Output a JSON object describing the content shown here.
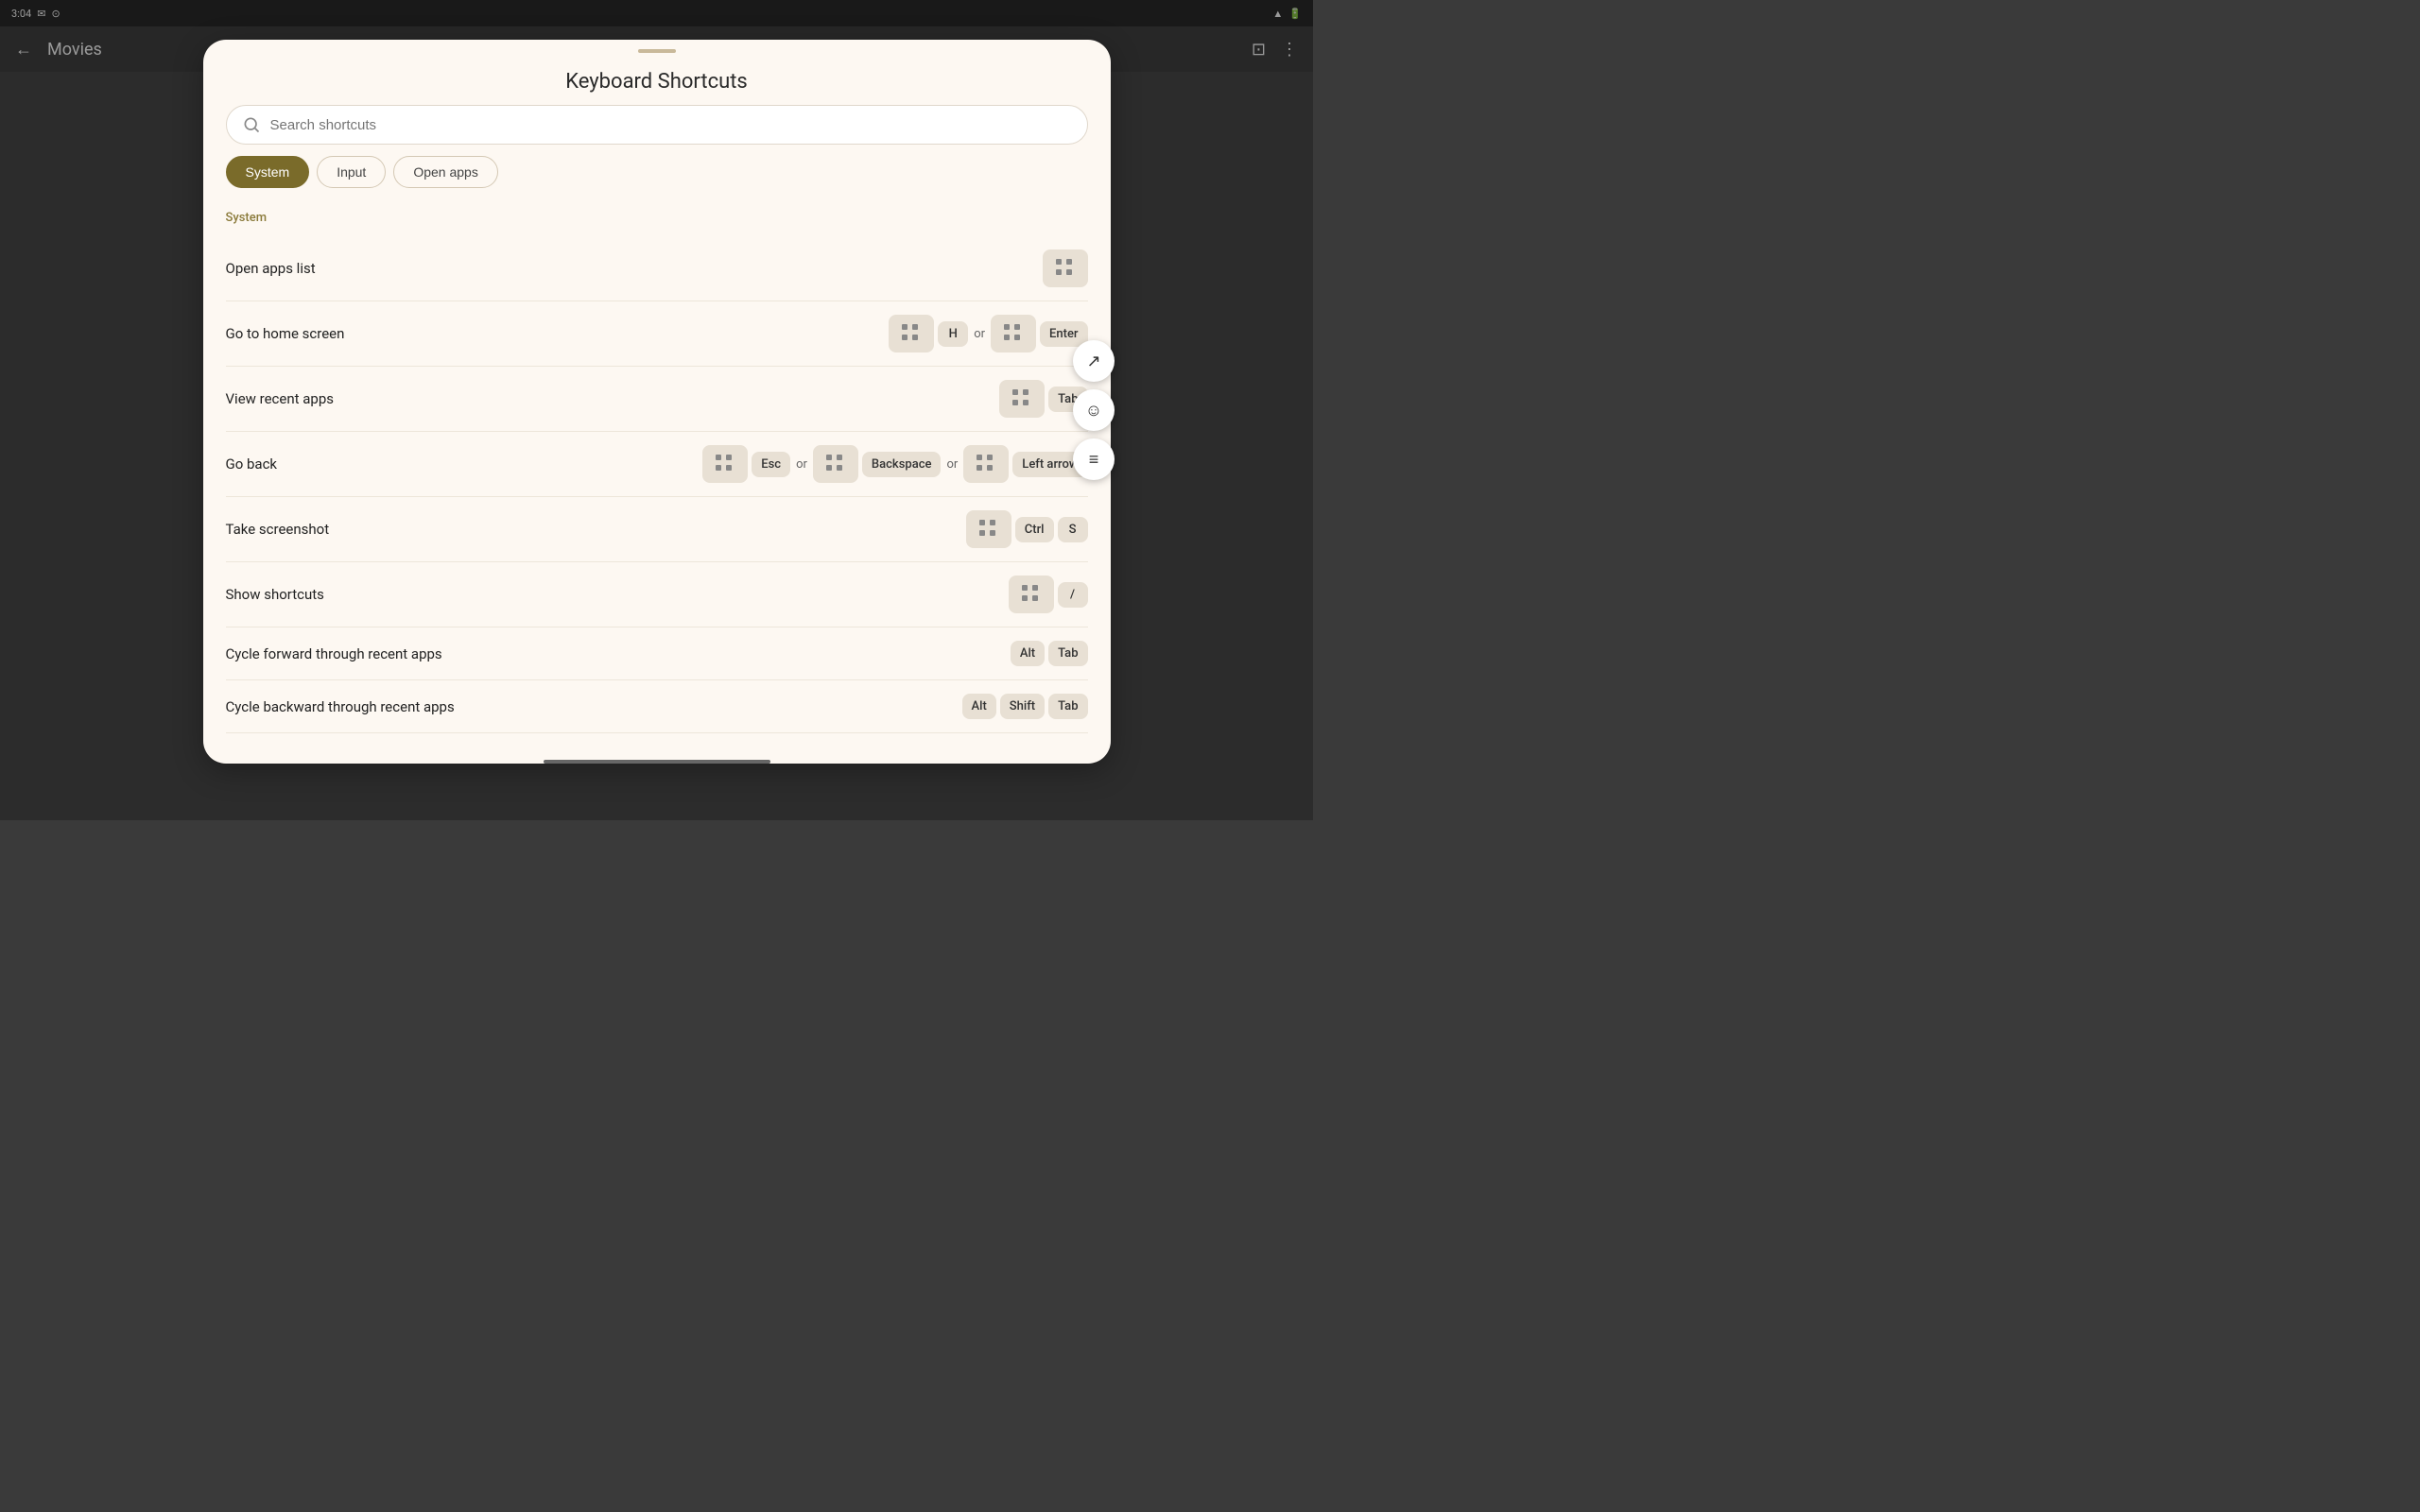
{
  "statusBar": {
    "time": "3:04",
    "icons": [
      "mail",
      "monitor"
    ],
    "rightIcons": [
      "wifi",
      "battery"
    ]
  },
  "appBar": {
    "title": "Movies",
    "backLabel": "←"
  },
  "modal": {
    "title": "Keyboard Shortcuts",
    "searchPlaceholder": "Search shortcuts",
    "tabs": [
      {
        "label": "System",
        "active": true
      },
      {
        "label": "Input",
        "active": false
      },
      {
        "label": "Open apps",
        "active": false
      }
    ],
    "sectionLabel": "System",
    "shortcuts": [
      {
        "name": "Open apps list",
        "keys": [
          {
            "type": "grid"
          }
        ]
      },
      {
        "name": "Go to home screen",
        "keys": [
          {
            "type": "grid"
          },
          {
            "type": "sep",
            "text": ""
          },
          {
            "type": "key",
            "text": "H"
          },
          {
            "type": "sep",
            "text": "or"
          },
          {
            "type": "grid"
          },
          {
            "type": "sep",
            "text": ""
          },
          {
            "type": "key",
            "text": "Enter"
          }
        ]
      },
      {
        "name": "View recent apps",
        "keys": [
          {
            "type": "grid"
          },
          {
            "type": "sep",
            "text": ""
          },
          {
            "type": "key",
            "text": "Tab"
          }
        ]
      },
      {
        "name": "Go back",
        "keys": [
          {
            "type": "grid"
          },
          {
            "type": "sep",
            "text": ""
          },
          {
            "type": "key",
            "text": "Esc"
          },
          {
            "type": "sep",
            "text": "or"
          },
          {
            "type": "grid"
          },
          {
            "type": "sep",
            "text": ""
          },
          {
            "type": "key",
            "text": "Backspace"
          },
          {
            "type": "sep",
            "text": "or"
          },
          {
            "type": "grid"
          },
          {
            "type": "sep",
            "text": ""
          },
          {
            "type": "key",
            "text": "Left arrow"
          }
        ]
      },
      {
        "name": "Take screenshot",
        "keys": [
          {
            "type": "grid"
          },
          {
            "type": "sep",
            "text": ""
          },
          {
            "type": "key",
            "text": "Ctrl"
          },
          {
            "type": "sep",
            "text": ""
          },
          {
            "type": "key",
            "text": "S"
          }
        ]
      },
      {
        "name": "Show shortcuts",
        "keys": [
          {
            "type": "grid"
          },
          {
            "type": "sep",
            "text": ""
          },
          {
            "type": "key",
            "text": "/"
          }
        ]
      },
      {
        "name": "Cycle forward through recent apps",
        "keys": [
          {
            "type": "key",
            "text": "Alt"
          },
          {
            "type": "sep",
            "text": ""
          },
          {
            "type": "key",
            "text": "Tab"
          }
        ]
      },
      {
        "name": "Cycle backward through recent apps",
        "keys": [
          {
            "type": "key",
            "text": "Alt"
          },
          {
            "type": "sep",
            "text": ""
          },
          {
            "type": "key",
            "text": "Shift"
          },
          {
            "type": "sep",
            "text": ""
          },
          {
            "type": "key",
            "text": "Tab"
          }
        ]
      }
    ],
    "floatButtons": [
      {
        "icon": "↗",
        "name": "expand"
      },
      {
        "icon": "☺",
        "name": "emoji"
      },
      {
        "icon": "≡",
        "name": "menu"
      }
    ]
  }
}
